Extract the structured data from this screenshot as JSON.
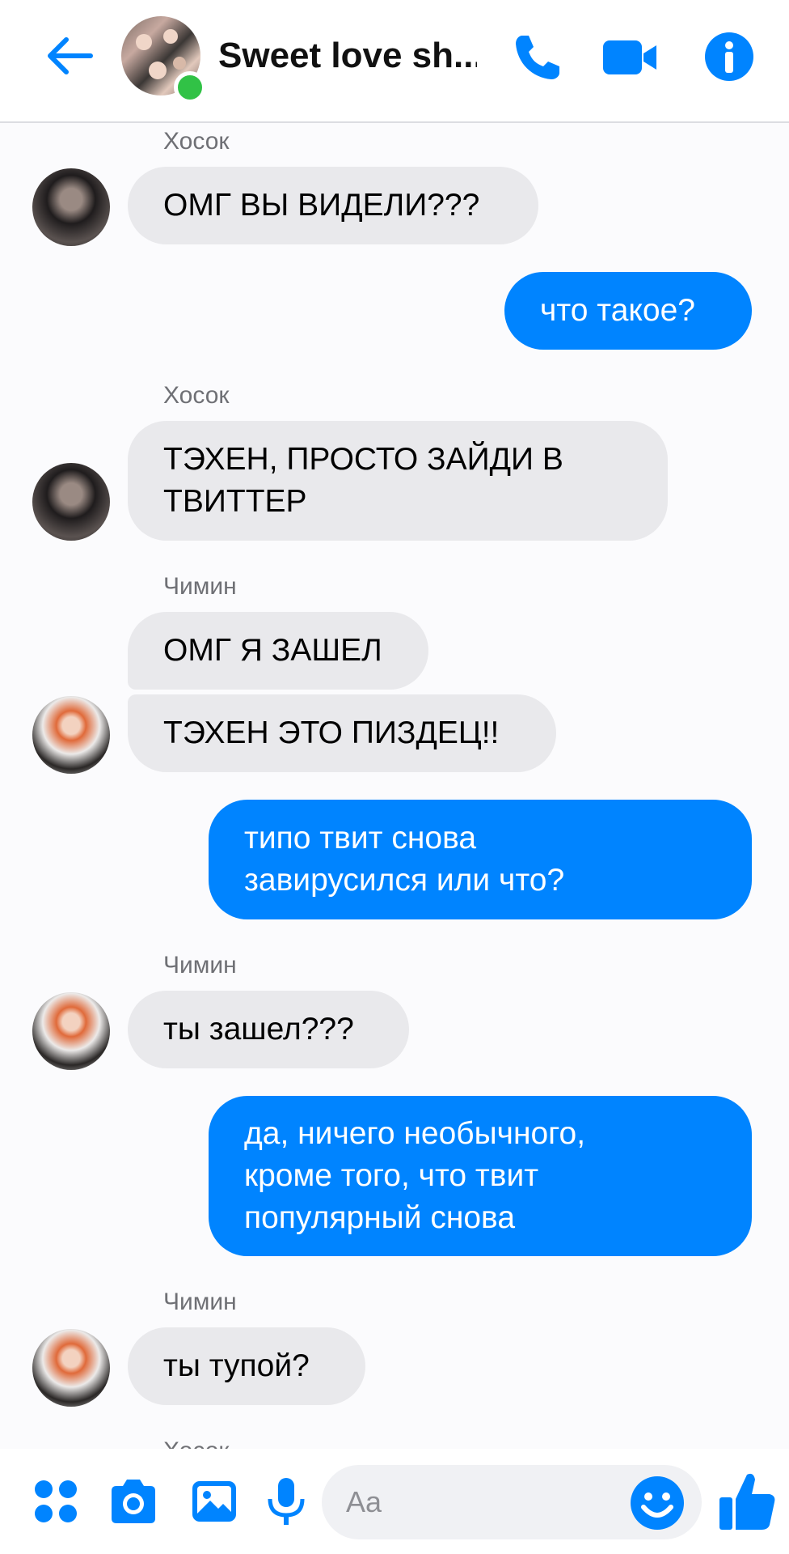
{
  "header": {
    "title": "Sweet love sh...",
    "accent_color": "#0084ff",
    "icons": [
      "back-arrow-icon",
      "phone-icon",
      "video-camera-icon",
      "info-icon"
    ]
  },
  "messages": [
    {
      "id": 1,
      "sender": "Хосок",
      "direction": "incoming",
      "text": "ОМГ ВЫ ВИДЕЛИ???"
    },
    {
      "id": 2,
      "direction": "outgoing",
      "text": "что такое?"
    },
    {
      "id": 3,
      "sender": "Хосок",
      "direction": "incoming",
      "text": "ТЭХЕН, ПРОСТО ЗАЙДИ В\nТВИТТЕР"
    },
    {
      "id": 4,
      "sender": "Чимин",
      "direction": "incoming",
      "text": "ОМГ Я ЗАШЕЛ"
    },
    {
      "id": 5,
      "direction": "incoming",
      "text": "ТЭХЕН ЭТО ПИЗДЕЦ!!"
    },
    {
      "id": 6,
      "direction": "outgoing",
      "text": "типо твит снова\nзавирусился или что?"
    },
    {
      "id": 7,
      "sender": "Чимин",
      "direction": "incoming",
      "text": "ты зашел???"
    },
    {
      "id": 8,
      "direction": "outgoing",
      "text": "да, ничего необычного,\nкроме того, что твит\nпопулярный снова"
    },
    {
      "id": 9,
      "sender": "Чимин",
      "direction": "incoming",
      "text": "ты тупой?"
    },
    {
      "id": 10,
      "sender": "Хосок",
      "direction": "incoming",
      "partial": true
    }
  ],
  "composer": {
    "placeholder": "Aa",
    "icons": [
      "apps-grid-icon",
      "camera-icon",
      "gallery-icon",
      "microphone-icon",
      "emoji-icon",
      "thumbs-up-icon"
    ]
  },
  "colors": {
    "outgoing_bubble": "#0084ff",
    "incoming_bubble": "#e9e9ec",
    "online": "#31c246"
  }
}
